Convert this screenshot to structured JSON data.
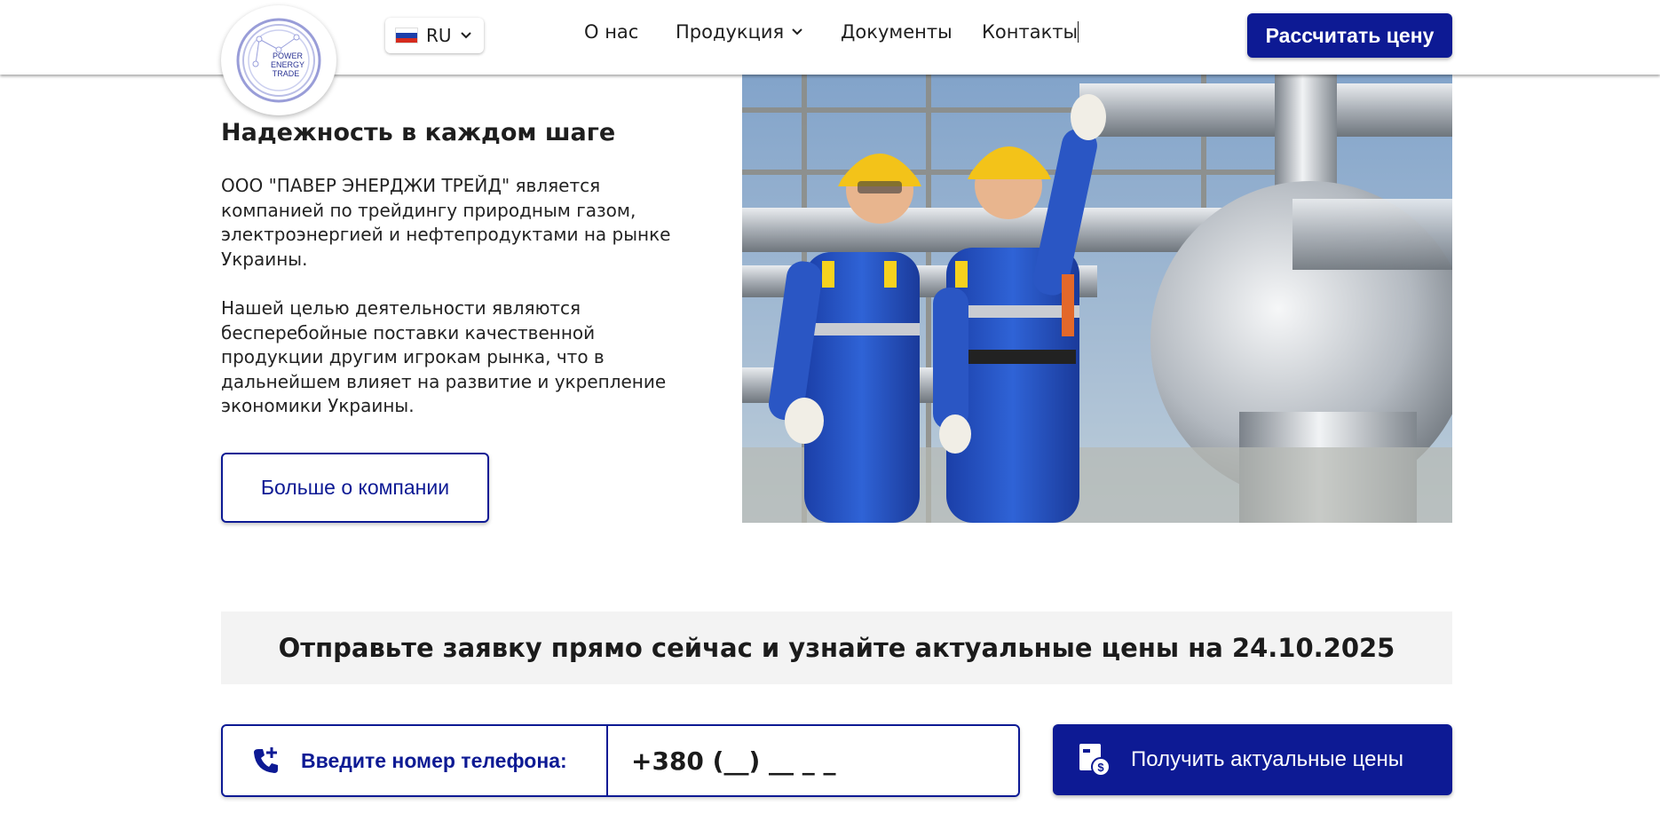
{
  "header": {
    "logo_text": [
      "POWER",
      "ENERGY",
      "TRADE"
    ],
    "lang": {
      "code": "RU",
      "flag_colors": [
        "#ffffff",
        "#1c3faa",
        "#d52b1e"
      ]
    },
    "nav": [
      {
        "label": "О нас"
      },
      {
        "label": "Продукция"
      },
      {
        "label": "Документы"
      },
      {
        "label": "Контакты"
      }
    ],
    "cta_label": "Рассчитать цену"
  },
  "about": {
    "title": "Надежность в каждом шаге",
    "paragraph1": "ООО \"ПАВЕР ЭНЕРДЖИ ТРЕЙД\" является компанией по трейдингу природным газом, электроэнергией и нефтепродуктами на рынке Украины.",
    "paragraph2": "Нашей целью деятельности являются бесперебойные поставки качественной продукции другим игрокам рынка, что в дальнейшем влияет на развитие и укрепление экономики Украины.",
    "more_label": "Больше о компании"
  },
  "request": {
    "heading": "Отправьте заявку прямо сейчас и узнайте актуальные цены на 24.10.2025",
    "phone_label": "Введите номер телефона:",
    "phone_placeholder": "+380 (__) __ _ _",
    "submit_label": "Получить актуальные цены"
  },
  "colors": {
    "brand": "#0d1a94",
    "band": "#f3f3f3"
  }
}
